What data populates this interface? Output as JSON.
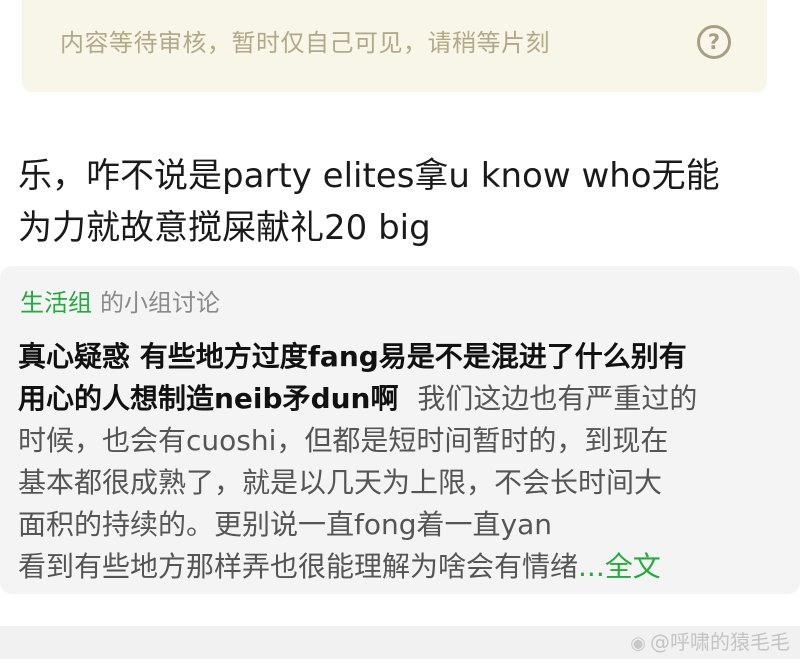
{
  "notice": {
    "text": "内容等待审核，暂时仅自己可见，请稍等片刻",
    "help_icon": "?"
  },
  "post": {
    "line1": "乐，咋不说是party elites拿u know who无能",
    "line2": "为力就故意搅屎献礼20 big"
  },
  "group_card": {
    "group_name": "生活组",
    "group_suffix": "的小组讨论",
    "title_line1": "真心疑惑 有些地方过度fang易是不是混进了什么别有",
    "title_line2": "用心的人想制造neib矛dun啊",
    "body_line2_rest": "我们这边也有严重过的",
    "body_line3": "时候，也会有cuoshi，但都是短时间暂时的，到现在",
    "body_line4": "基本都很成熟了，就是以几天为上限，不会长时间大",
    "body_line5": "面积的持续的。更别说一直fong着一直yan",
    "body_line6": "看到有些地方那样弄也很能理解为啥会有情绪",
    "more_link": "...全文"
  },
  "watermark": {
    "icon": "weibo-icon",
    "text": "@呼啸的猿毛毛"
  },
  "colors": {
    "notice_bg": "#f8f5e9",
    "notice_text": "#b4a986",
    "accent_green": "#21ac3c",
    "card_bg": "#f4f4f4"
  }
}
